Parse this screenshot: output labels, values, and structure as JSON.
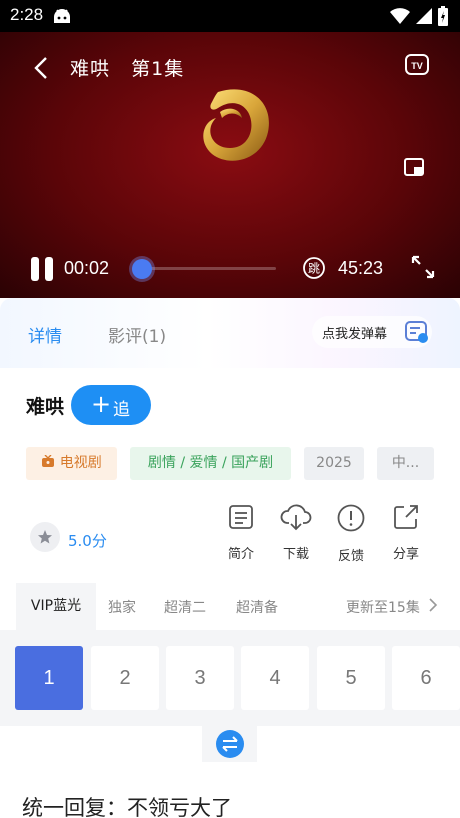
{
  "status_bar": {
    "time": "2:28"
  },
  "player": {
    "title": "难哄",
    "episode": "第1集",
    "current_time": "00:02",
    "total_time": "45:23",
    "progress": 0.01,
    "skip_label": "跳"
  },
  "tabs": [
    {
      "label": "详情",
      "active": true
    },
    {
      "label": "影评(1)",
      "active": false
    }
  ],
  "danmu_button": {
    "label": "点我发弹幕"
  },
  "show": {
    "title": "难哄",
    "follow_label": "追"
  },
  "tags": {
    "type": "电视剧",
    "genre": "剧情 / 爱情 / 国产剧",
    "year": "2025",
    "region": "中..."
  },
  "rating": {
    "text": "5.0分"
  },
  "actions": [
    {
      "label": "简介",
      "icon": "document-icon"
    },
    {
      "label": "下载",
      "icon": "cloud-download-icon"
    },
    {
      "label": "反馈",
      "icon": "alert-circle-icon"
    },
    {
      "label": "分享",
      "icon": "share-icon"
    }
  ],
  "sources": [
    {
      "label": "VIP蓝光",
      "active": true
    },
    {
      "label": "独家",
      "active": false
    },
    {
      "label": "超清二",
      "active": false
    },
    {
      "label": "超清备",
      "active": false
    }
  ],
  "update_info": "更新至15集",
  "episodes": [
    "1",
    "2",
    "3",
    "4",
    "5",
    "6"
  ],
  "comment": "统一回复：不领亏大了",
  "colors": {
    "accent": "#2a8cf0",
    "episode_active": "#4a6ee0",
    "follow_button": "#1e8ff4"
  }
}
